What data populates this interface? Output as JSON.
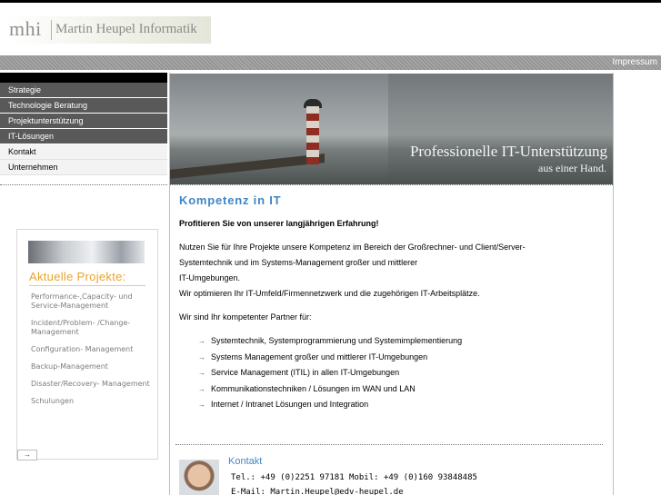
{
  "header": {
    "logo_mark": "mhi",
    "logo_name": "Martin Heupel Informatik"
  },
  "topnav": {
    "impressum": "Impressum"
  },
  "sidebar": {
    "items": [
      {
        "label": "Strategie",
        "style": "dark"
      },
      {
        "label": "Technologie Beratung",
        "style": "dark"
      },
      {
        "label": "Projektunterstützung",
        "style": "dark"
      },
      {
        "label": "IT-Lösungen",
        "style": "dark"
      },
      {
        "label": "Kontakt",
        "style": "light"
      },
      {
        "label": "Unternehmen",
        "style": "light"
      }
    ]
  },
  "projects": {
    "title": "Aktuelle Projekte:",
    "items": [
      "Performance-,Capacity- und Service-Management",
      "Incident/Problem- /Change-Management",
      "Configuration- Management",
      "Backup-Management",
      "Disaster/Recovery- Management",
      "Schulungen"
    ],
    "more_icon": "→"
  },
  "banner": {
    "headline": "Professionelle IT-Unterstützung",
    "sub": "aus einer Hand."
  },
  "main": {
    "title": "Kompetenz in IT",
    "lead": "Profitieren Sie von unserer langjährigen Erfahrung!",
    "p1_line1": "Nutzen Sie für Ihre Projekte unsere Kompetenz im Bereich der Großrechner- und Client/Server-",
    "p1_line2": "Systemtechnik und im Systems-Management großer und mittlerer",
    "p1_line3": "IT-Umgebungen.",
    "p1_line4": "Wir optimieren Ihr IT-Umfeld/Firmennetzwerk und die zugehörigen IT-Arbeitsplätze.",
    "p2": "Wir sind Ihr kompetenter Partner für:",
    "bullet_icon": "→",
    "bullets": [
      "Systemtechnik, Systemprogrammierung und Systemimplementierung",
      "Systems Management großer und mittlerer IT-Umgebungen",
      "Service Management (ITIL) in allen IT-Umgebungen",
      "Kommunikationstechniken / Lösungen im WAN und LAN",
      "Internet / Intranet Lösungen und Integration"
    ]
  },
  "contact": {
    "title": "Kontakt",
    "tel": "Tel.: +49 (0)2251 97181   Mobil: +49 (0)160 93848485",
    "email": "E-Mail: Martin.Heupel@edv-heupel.de"
  },
  "colors": {
    "accent_blue": "#3f86c8",
    "accent_orange": "#e6a42d",
    "nav_dark": "#595959"
  }
}
